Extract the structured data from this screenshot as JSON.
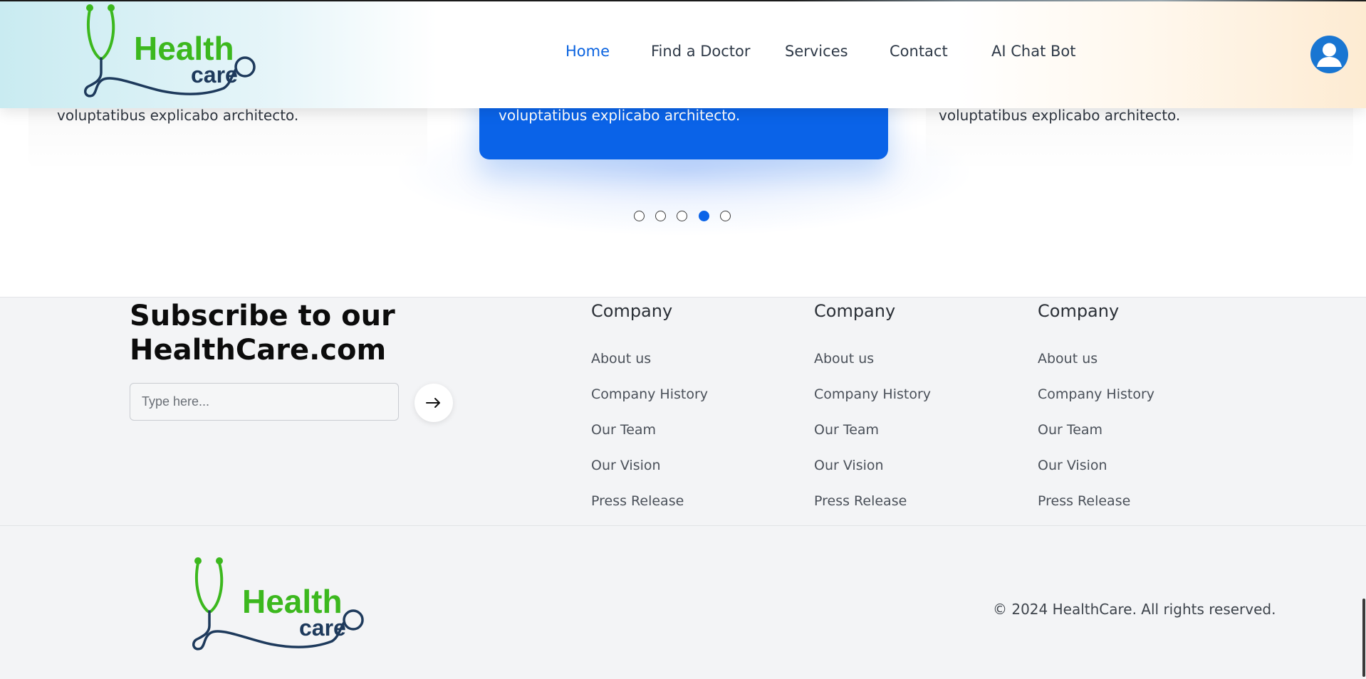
{
  "header": {
    "logo": {
      "word1": "Health",
      "word2": "care"
    },
    "nav": [
      {
        "label": "Home",
        "active": true
      },
      {
        "label": "Find a Doctor",
        "active": false
      },
      {
        "label": "Services",
        "active": false
      },
      {
        "label": "Contact",
        "active": false
      },
      {
        "label": "AI Chat Bot",
        "active": false
      }
    ],
    "user_icon": "user-avatar-icon"
  },
  "testimonials": {
    "cards": [
      {
        "text": "voluptatibus explicabo architecto."
      },
      {
        "text": "voluptatibus explicabo architecto.",
        "active": true
      },
      {
        "text": "voluptatibus explicabo architecto."
      }
    ],
    "dots_total": 5,
    "dots_active_index": 3
  },
  "footer": {
    "subscribe": {
      "title": "Subscribe to our HealthCare.com",
      "placeholder": "Type here...",
      "submit_icon": "arrow-right-icon"
    },
    "columns": [
      {
        "heading": "Company",
        "links": [
          "About us",
          "Company History",
          "Our Team",
          "Our Vision",
          "Press Release"
        ]
      },
      {
        "heading": "Company",
        "links": [
          "About us",
          "Company History",
          "Our Team",
          "Our Vision",
          "Press Release"
        ]
      },
      {
        "heading": "Company",
        "links": [
          "About us",
          "Company History",
          "Our Team",
          "Our Vision",
          "Press Release"
        ]
      }
    ],
    "logo": {
      "word1": "Health",
      "word2": "care"
    },
    "copyright": "© 2024 HealthCare. All rights reserved."
  },
  "colors": {
    "accent": "#0a63e8",
    "logo_green": "#3cb81e",
    "logo_navy": "#1e3a5c",
    "footer_bg": "#f3f4f6"
  }
}
